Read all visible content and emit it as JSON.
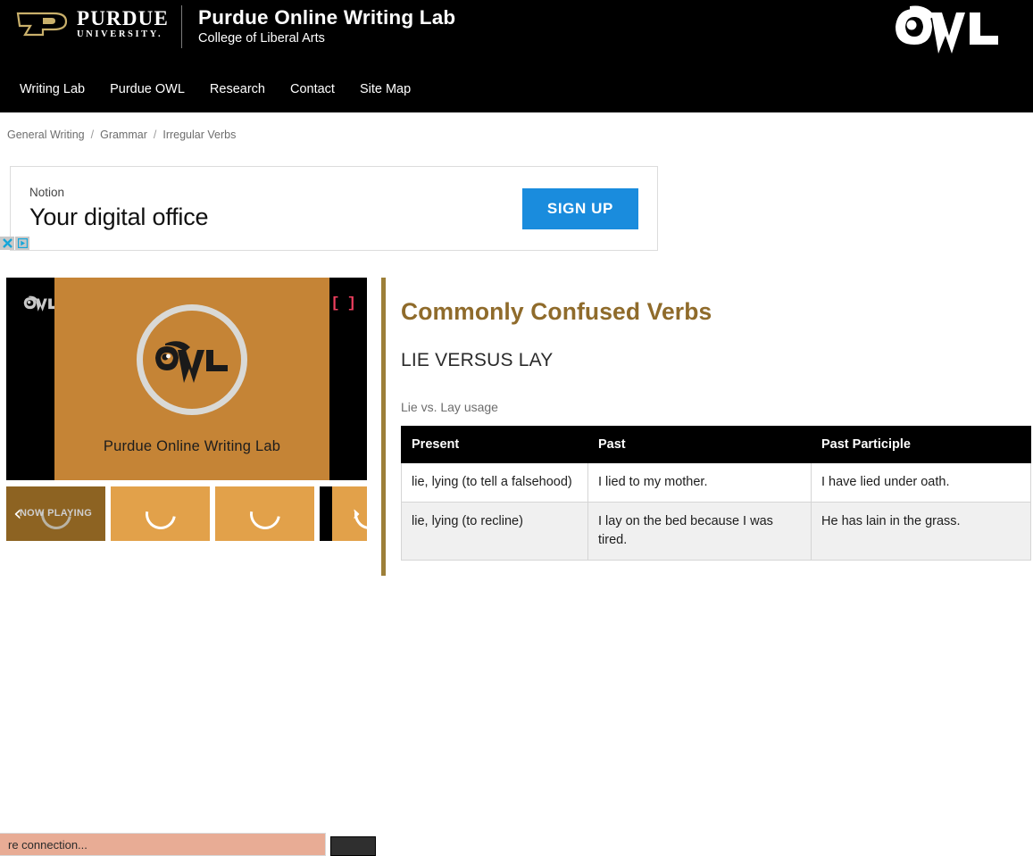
{
  "header": {
    "university_name": "PURDUE",
    "university_sub": "UNIVERSITY.",
    "site_title": "Purdue Online Writing Lab",
    "site_subtitle": "College of Liberal Arts",
    "owl_logo_alt": "OWL",
    "nav": [
      {
        "label": "Writing Lab"
      },
      {
        "label": "Purdue OWL"
      },
      {
        "label": "Research"
      },
      {
        "label": "Contact"
      },
      {
        "label": "Site Map"
      }
    ]
  },
  "breadcrumb": {
    "separator": "/",
    "items": [
      {
        "label": "General Writing"
      },
      {
        "label": "Grammar"
      },
      {
        "label": "Irregular Verbs"
      }
    ]
  },
  "ad": {
    "brand": "Notion",
    "headline": "Your digital office",
    "cta_label": "SIGN UP",
    "close_glyph": "✕",
    "adchoices_glyph": "▷",
    "accent_color": "#1a8cdd"
  },
  "video": {
    "caption": "Purdue Online Writing Lab",
    "watermark_alt": "OWL",
    "expand_glyph": "[ ]",
    "background_color": "#c58436",
    "thumbnails": [
      {
        "label": "NOW PLAYING",
        "state": "now-playing"
      },
      {
        "label": "",
        "state": "loading"
      },
      {
        "label": "",
        "state": "loading"
      },
      {
        "label": "",
        "state": "loading"
      }
    ],
    "prev_glyph": "‹",
    "next_glyph": "›"
  },
  "notice": {
    "text": "re connection...",
    "background_color": "#e8ac95"
  },
  "article": {
    "title": "Commonly Confused Verbs",
    "subtitle": "LIE VERSUS LAY",
    "accent_color": "#9d7f38",
    "table": {
      "caption": "Lie vs. Lay usage",
      "headers": [
        "Present",
        "Past",
        "Past Participle"
      ],
      "rows": [
        [
          "lie, lying (to tell a falsehood)",
          "I lied to my mother.",
          "I have lied under oath."
        ],
        [
          "lie, lying (to recline)",
          "I lay on the bed because I was tired.",
          "He has lain in the grass."
        ]
      ]
    }
  }
}
